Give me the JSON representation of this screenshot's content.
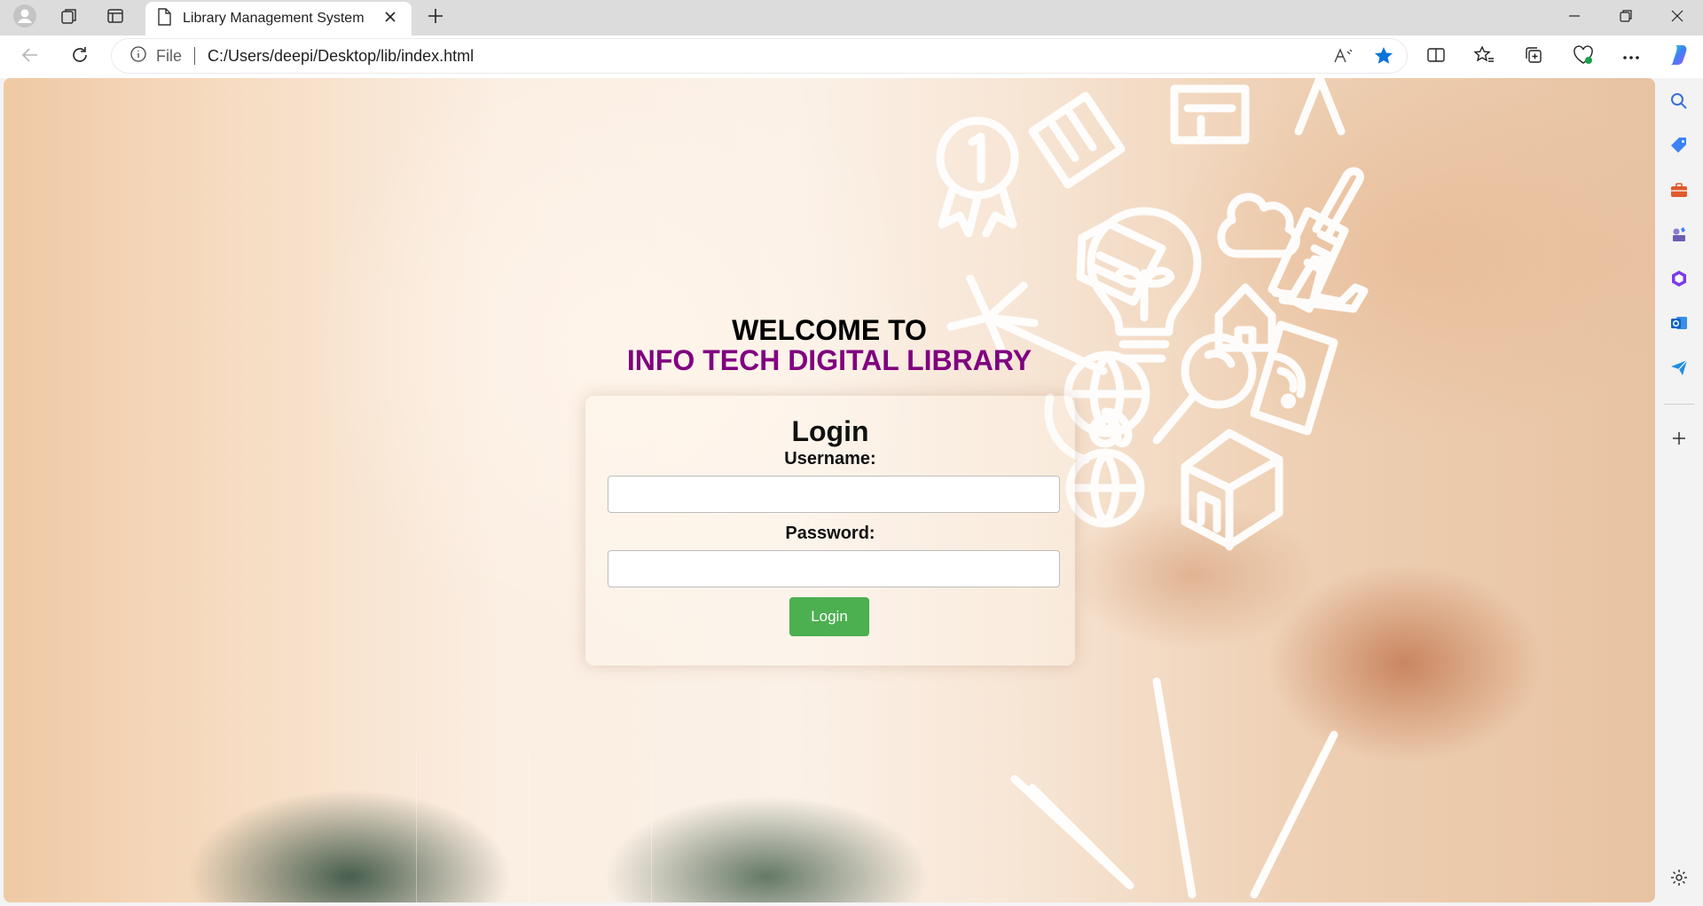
{
  "browser": {
    "tab": {
      "title": "Library Management System"
    },
    "address_bar": {
      "scheme_label": "File",
      "url": "C:/Users/deepi/Desktop/lib/index.html"
    }
  },
  "page": {
    "welcome_line1": "WELCOME TO",
    "welcome_line2": "INFO TECH DIGITAL LIBRARY",
    "login": {
      "title": "Login",
      "username_label": "Username:",
      "username_value": "",
      "password_label": "Password:",
      "password_value": "",
      "button_label": "Login"
    }
  },
  "colors": {
    "welcome_accent": "#800080",
    "login_button": "#4caf50",
    "favorite_star": "#0a74da"
  },
  "icons": {
    "tabbar": [
      "profile-icon",
      "workspaces-icon",
      "vertical-tabs-icon",
      "page-icon",
      "close-icon",
      "new-tab-icon"
    ],
    "window": [
      "minimize-icon",
      "restore-icon",
      "close-window-icon"
    ],
    "toolbar": [
      "back-icon",
      "refresh-icon",
      "info-icon",
      "read-aloud-icon",
      "favorite-star-icon",
      "split-screen-icon",
      "favorites-icon",
      "collections-icon",
      "browser-essentials-icon",
      "more-icon",
      "copilot-icon"
    ],
    "sidebar": [
      "search-icon",
      "shopping-tag-icon",
      "tools-icon",
      "games-icon",
      "microsoft365-icon",
      "outlook-icon",
      "send-icon",
      "add-icon",
      "settings-icon"
    ]
  }
}
